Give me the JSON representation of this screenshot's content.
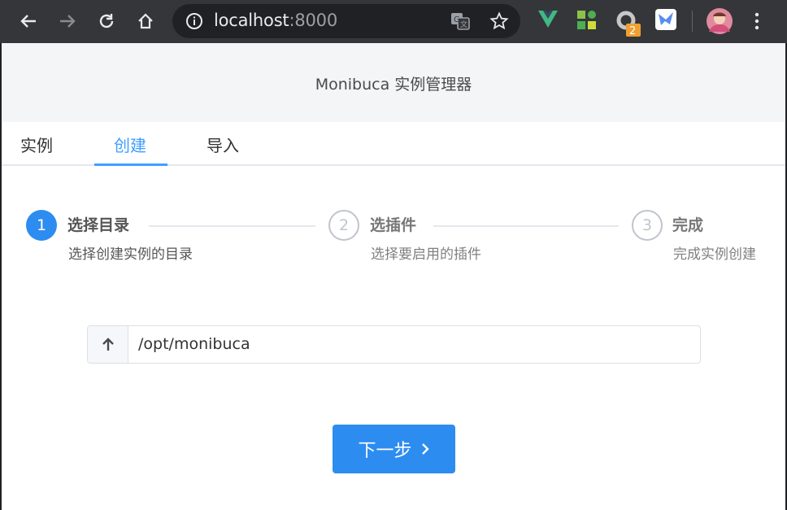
{
  "browser": {
    "url_host": "localhost",
    "url_port": ":8000",
    "extensions": [
      {
        "name": "vue-devtools-icon",
        "color": "#41b883"
      },
      {
        "name": "grid-extension-icon",
        "color": "#8bc34a"
      },
      {
        "name": "ring-extension-icon",
        "badge": "2"
      },
      {
        "name": "bird-extension-icon",
        "color": "#5b8def"
      }
    ]
  },
  "header": {
    "title": "Monibuca 实例管理器"
  },
  "tabs": [
    {
      "label": "实例"
    },
    {
      "label": "创建"
    },
    {
      "label": "导入"
    }
  ],
  "steps": [
    {
      "number": "1",
      "title": "选择目录",
      "description": "选择创建实例的目录",
      "status": "active"
    },
    {
      "number": "2",
      "title": "选插件",
      "description": "选择要启用的插件",
      "status": "wait"
    },
    {
      "number": "3",
      "title": "完成",
      "description": "完成实例创建",
      "status": "wait"
    }
  ],
  "path_input": {
    "value": "/opt/monibuca"
  },
  "next_button": {
    "label": "下一步"
  },
  "colors": {
    "accent": "#409eff",
    "primary": "#2d8cf0"
  }
}
